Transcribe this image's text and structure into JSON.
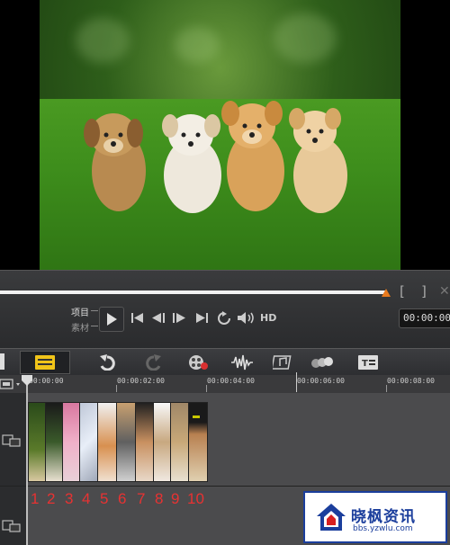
{
  "preview": {
    "image_description_icon": "puppies-photo"
  },
  "transport": {
    "mode_project": "项目",
    "mode_clip": "素材",
    "hd_label": "HD",
    "timecode": "00:00:00",
    "mark_in": "[",
    "mark_out": "]"
  },
  "ruler": {
    "labels": [
      "00:00:00",
      "00:00:02:00",
      "00:00:04:00",
      "00:00:06:00",
      "00:00:08:00"
    ]
  },
  "clips": {
    "numbers": [
      "1",
      "2",
      "3",
      "4",
      "5",
      "6",
      "7",
      "8",
      "9",
      "10"
    ]
  },
  "watermark": {
    "title": "晓枫资讯",
    "url": "bbs.yzwlu.com"
  },
  "colors": {
    "accent_orange": "#e87a1e",
    "clip_number_red": "#e83232",
    "watermark_blue": "#1b3e9c"
  }
}
